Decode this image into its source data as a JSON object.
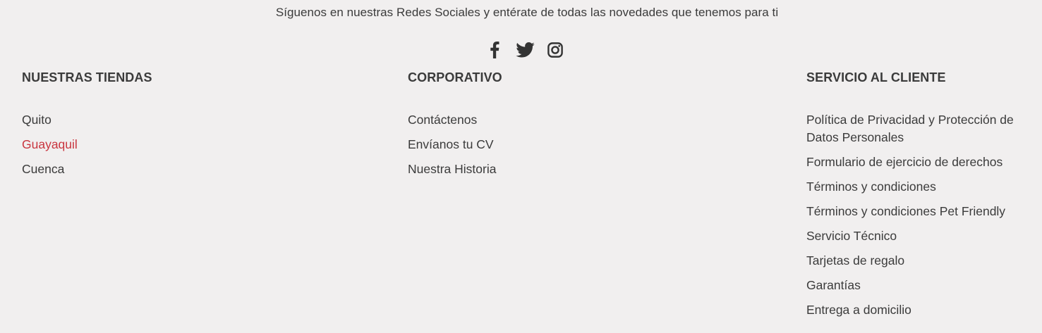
{
  "tagline": "Síguenos en nuestras Redes Sociales y entérate de todas las novedades que tenemos para ti",
  "social": {
    "icons": [
      "facebook-icon",
      "twitter-icon",
      "instagram-icon"
    ],
    "icon_color": "#333333"
  },
  "colors": {
    "background": "#f1efef",
    "text": "#3b3b3b",
    "active_link": "#c9353f"
  },
  "columns": [
    {
      "title": "NUESTRAS TIENDAS",
      "links": [
        "Quito",
        "Guayaquil",
        "Cuenca"
      ],
      "active_link": "Guayaquil"
    },
    {
      "title": "CORPORATIVO",
      "links": [
        "Contáctenos",
        "Envíanos tu CV",
        "Nuestra Historia"
      ]
    },
    {
      "title": "SERVICIO AL CLIENTE",
      "links": [
        "Política de Privacidad y Protección de Datos Personales",
        "Formulario de ejercicio de derechos",
        "Términos y condiciones",
        "Términos y condiciones Pet Friendly",
        "Servicio Técnico",
        "Tarjetas de regalo",
        "Garantías",
        "Entrega a domicilio"
      ]
    }
  ]
}
